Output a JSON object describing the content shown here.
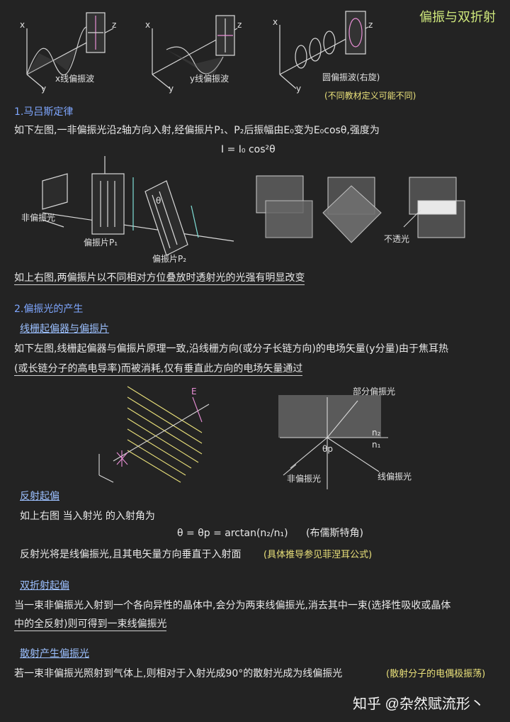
{
  "title": "偏振与双折射",
  "top_figs": {
    "axis_x": "x",
    "axis_y": "y",
    "axis_z": "z",
    "cap1": "x线偏振波",
    "cap2": "y线偏振波",
    "cap3": "圆偏振波(右旋)",
    "cap3_note": "(不同教材定义可能不同)"
  },
  "s1": {
    "heading": "1.马吕斯定律",
    "line1": "如下左图,一非偏振光沿z轴方向入射,经偏振片P₁、P₂后振幅由E₀变为E₀cosθ,强度为",
    "formula": "I = I₀ cos²θ",
    "fig_unpol": "非偏振光",
    "fig_p1": "偏振片P₁",
    "fig_p2": "偏振片P₂",
    "fig_theta": "θ",
    "opaque": "不透光",
    "line2": "如上右图,两偏振片以不同相对方位叠放时透射光的光强有明显改变"
  },
  "s2": {
    "heading": "2.偏振光的产生",
    "sub1": "线栅起偏器与偏振片",
    "p1a": "如下左图,线栅起偏器与偏振片原理一致,沿线栅方向(或分子长链方向)的电场矢量(y分量)由于焦耳热",
    "p1b": "(或长链分子的高电导率)而被消耗,仅有垂直此方向的电场矢量通过",
    "fig_E": "E",
    "fig_partial": "部分偏振光",
    "fig_n2": "n₂",
    "fig_n1": "n₁",
    "fig_thetap": "θp",
    "fig_unpol2": "非偏振光",
    "fig_linear": "线偏振光",
    "sub2": "反射起偏",
    "p2a": "如上右图 当入射光 的入射角为",
    "formula2": "θ = θp = arctan(n₂/n₁)",
    "formula2_note": "(布儒斯特角)",
    "p2b": "反射光将是线偏振光,且其电矢量方向垂直于入射面",
    "p2b_note": "(具体推导参见菲涅耳公式)",
    "sub3": "双折射起偏",
    "p3a": "当一束非偏振光入射到一个各向异性的晶体中,会分为两束线偏振光,消去其中一束(选择性吸收或晶体",
    "p3b": "中的全反射)则可得到一束线偏振光",
    "sub4": "散射产生偏振光",
    "p4": "若一束非偏振光照射到气体上,则相对于入射光成90°的散射光成为线偏振光",
    "p4_note": "(散射分子的电偶极振荡)"
  },
  "watermark": "知乎 @杂然赋流形丶",
  "colors": {
    "bg": "#232323",
    "blue": "#7fa7ff",
    "yellow": "#e9e07a",
    "green": "#cfe87c",
    "pink": "#e98fd6"
  }
}
